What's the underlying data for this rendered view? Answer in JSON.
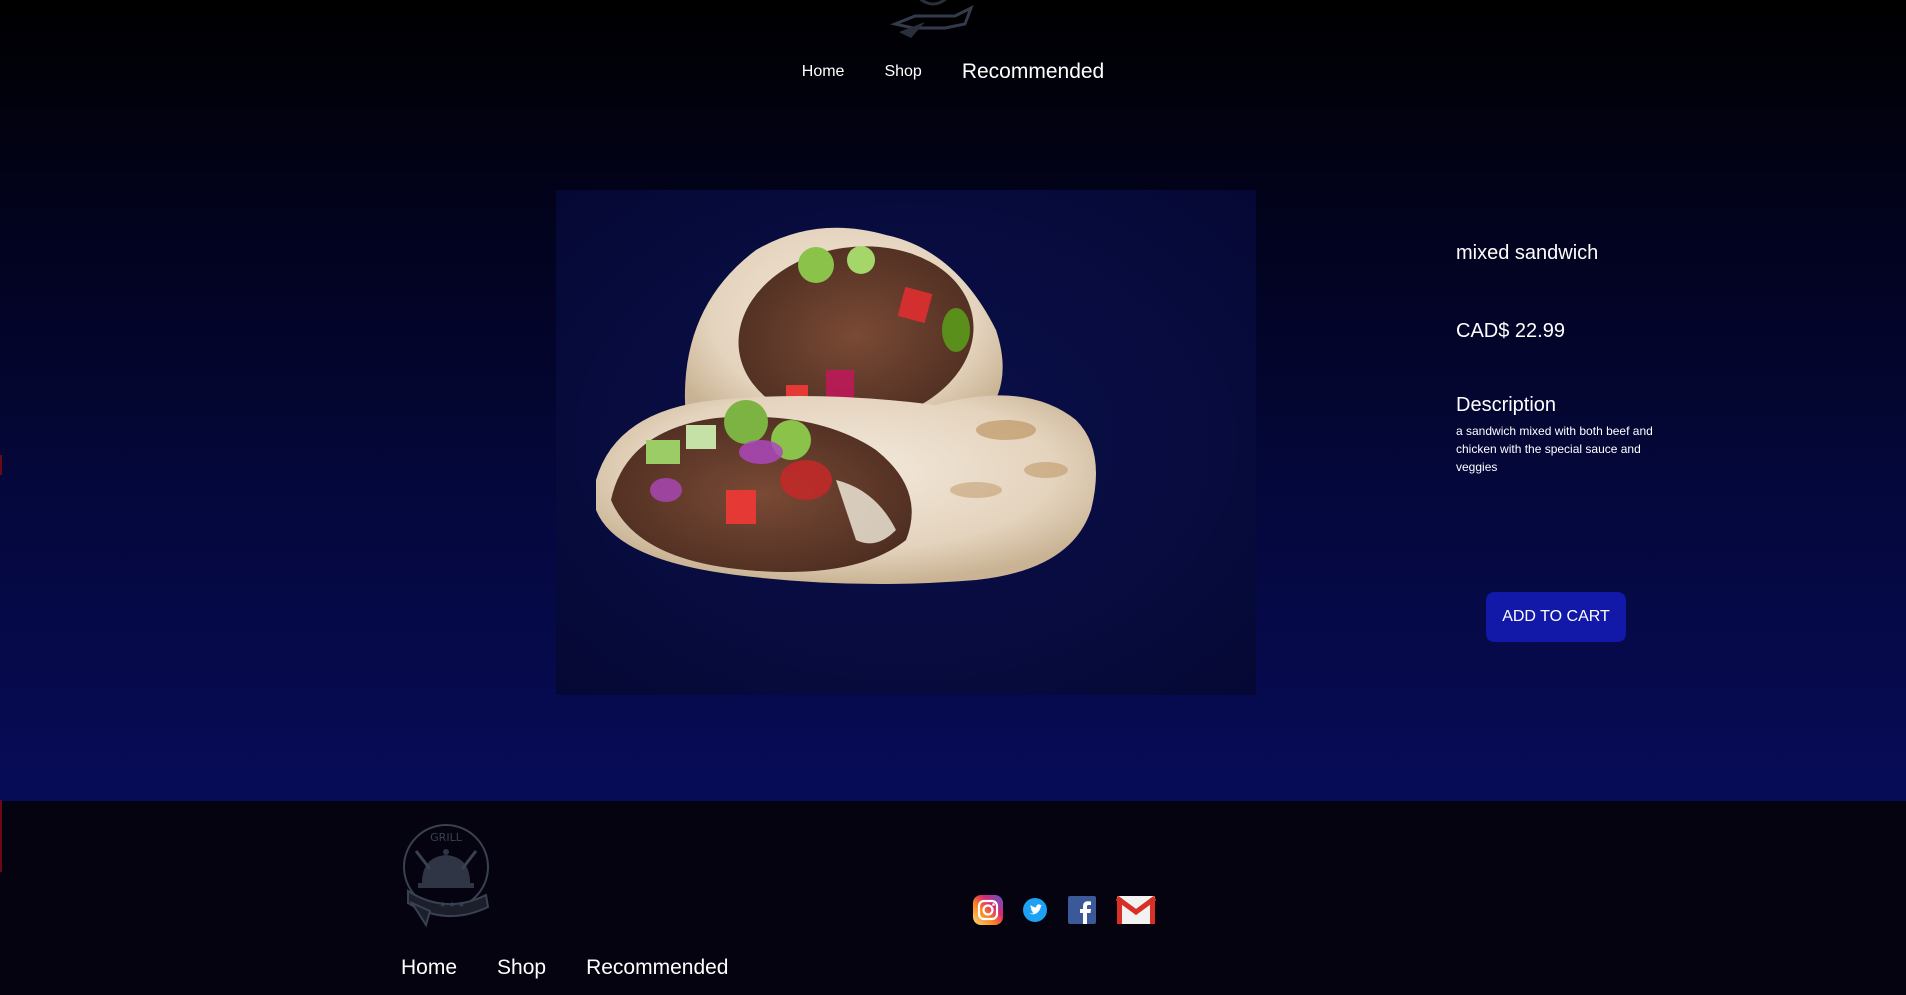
{
  "nav": {
    "items": [
      {
        "label": "Home",
        "active": false
      },
      {
        "label": "Shop",
        "active": false
      },
      {
        "label": "Recommended",
        "active": true
      }
    ]
  },
  "product": {
    "name": "mixed sandwich",
    "price": "CAD$ 22.99",
    "description_heading": "Description",
    "description": "a sandwich mixed with both beef and chicken with the special sauce and veggies",
    "add_to_cart_label": "ADD TO CART",
    "image_alt": "wrap sandwich"
  },
  "footer": {
    "nav": [
      {
        "label": "Home"
      },
      {
        "label": "Shop"
      },
      {
        "label": "Recommended"
      }
    ],
    "logo_text": "GRILL",
    "social": [
      "instagram-icon",
      "twitter-icon",
      "facebook-icon",
      "gmail-icon"
    ]
  },
  "colors": {
    "button": "#1218a8",
    "footer_bg": "#04030f",
    "hero_bottom": "#070c58"
  }
}
